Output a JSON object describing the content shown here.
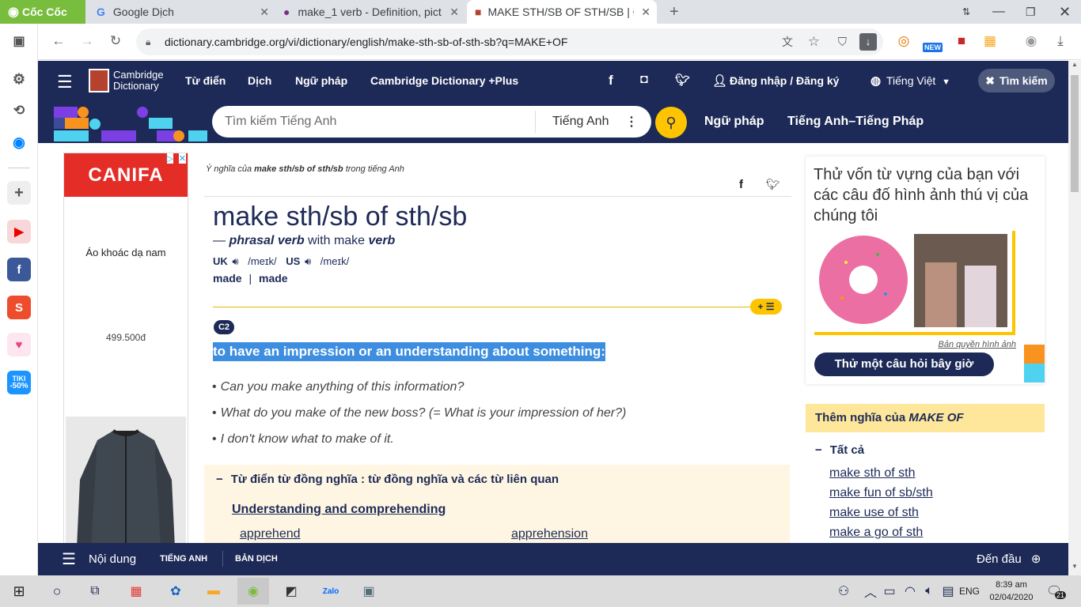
{
  "browser": {
    "tabs": [
      {
        "label": "Cốc Cốc"
      },
      {
        "label": "Google Dịch"
      },
      {
        "label": "make_1 verb - Definition, pict"
      },
      {
        "label": "MAKE STH/SB OF STH/SB | Đị"
      }
    ],
    "url": "dictionary.cambridge.org/vi/dictionary/english/make-sth-sb-of-sth-sb?q=MAKE+OF",
    "new_badge": "NEW",
    "colors": {
      "tabbar": "#dee1e6",
      "accent": "#78bd3d"
    }
  },
  "sidebar": {
    "tiki": "TIKI",
    "tiki_discount": "-50%"
  },
  "site": {
    "logo_line1": "Cambridge",
    "logo_line2": "Dictionary",
    "nav": [
      "Từ điển",
      "Dịch",
      "Ngữ pháp",
      "Cambridge Dictionary +Plus"
    ],
    "login": "Đăng nhập / Đăng ký",
    "language": "Tiếng Việt",
    "search_button": "Tìm kiếm",
    "search_placeholder": "Tìm kiếm Tiếng Anh",
    "search_lang": "Tiếng Anh",
    "links": [
      "Ngữ pháp",
      "Tiếng Anh–Tiếng Pháp"
    ],
    "colors": {
      "navy": "#1d2a57",
      "yellow": "#fec400",
      "highlight": "#3d8ee0"
    }
  },
  "ad": {
    "brand": "CANIFA",
    "product": "Áo khoác dạ nam",
    "price": "499.500đ"
  },
  "entry": {
    "breadcrumb_prefix": "Ý nghĩa của ",
    "breadcrumb_term": "make sth/sb of sth/sb",
    "breadcrumb_suffix": " trong tiếng Anh",
    "headword": "make sth/sb of sth/sb",
    "dash": "— ",
    "pos": "phrasal verb",
    "with": " with make ",
    "pos2": "verb",
    "uk": "UK",
    "uk_ipa": "/meɪk/",
    "us": "US",
    "us_ipa": "/meɪk/",
    "form1": "made",
    "sep": "|",
    "form2": "made",
    "level": "C2",
    "definition": "to have an impression or an understanding about something:",
    "examples": [
      "Can you make anything of this information?",
      "What do you make of the new boss? (= What is your impression of her?)",
      "I don't know what to make of it."
    ],
    "bullet": "•",
    "thesaurus_title": "Từ điển từ đồng nghĩa : từ đồng nghĩa và các từ liên quan",
    "thesaurus_heading": "Understanding and comprehending",
    "thesaurus_words": [
      "apprehend",
      "apprehension"
    ]
  },
  "quiz": {
    "text": "Thử vốn từ vựng của bạn với các câu đố hình ảnh thú vị của chúng tôi",
    "credit": "Bản quyền hình ảnh",
    "button": "Thử một câu hỏi bây giờ"
  },
  "more": {
    "title_prefix": "Thêm nghĩa của ",
    "title_term": "MAKE OF",
    "all": "Tất cả",
    "links": [
      "make sth of sth",
      "make fun of sb/sth",
      "make use of sth",
      "make a go of sth"
    ]
  },
  "bottom": {
    "contents": "Nội dung",
    "english": "TIẾNG ANH",
    "translation": "BẢN DỊCH",
    "top": "Đến đầu"
  },
  "taskbar": {
    "lang": "ENG",
    "time": "8:39 am",
    "date": "02/04/2020",
    "notif": "21"
  }
}
